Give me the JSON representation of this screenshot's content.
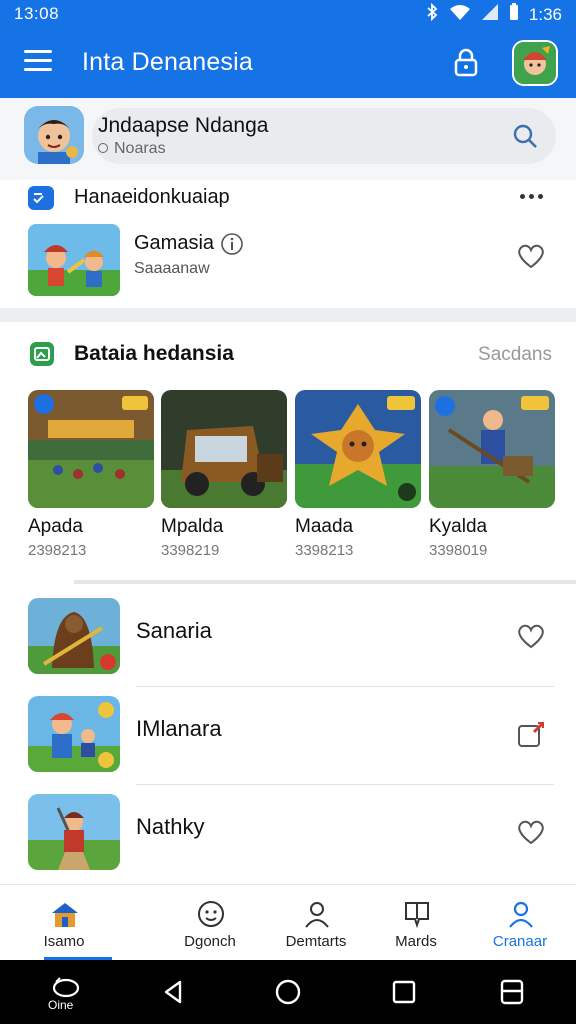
{
  "status_bar": {
    "time": "13:08",
    "right_time": "1:36"
  },
  "app_bar": {
    "title": "Inta Denanesia"
  },
  "search": {
    "title": "Jndaapse Ndanga",
    "placeholder": "Noaras"
  },
  "section_recent": {
    "title": "Hanaeidonkuaiap",
    "item": {
      "name": "Gamasia",
      "subtitle": "Saaaanaw"
    }
  },
  "section_popular": {
    "title": "Bataia hedansia",
    "see_all": "Sacdans",
    "cards": [
      {
        "name": "Apada",
        "subtitle": "2398213"
      },
      {
        "name": "Mpalda",
        "subtitle": "3398219"
      },
      {
        "name": "Maada",
        "subtitle": "3398213"
      },
      {
        "name": "Kyalda",
        "subtitle": "3398019"
      }
    ]
  },
  "list": [
    {
      "name": "Sanaria"
    },
    {
      "name": "IMlanara"
    },
    {
      "name": "Nathky"
    }
  ],
  "bottom_nav": [
    {
      "label": "Isamo",
      "icon": "home-icon",
      "active": false
    },
    {
      "label": "Dgonch",
      "icon": "face-icon",
      "active": false
    },
    {
      "label": "Demtarts",
      "icon": "person-icon",
      "active": false
    },
    {
      "label": "Mards",
      "icon": "bookmark-icon",
      "active": false
    },
    {
      "label": "Cranaar",
      "icon": "profile-icon",
      "active": true
    }
  ],
  "system_nav": {
    "label": "Oine"
  },
  "colors": {
    "primary": "#1673e6",
    "background": "#ffffff",
    "divider": "#eceef1"
  }
}
